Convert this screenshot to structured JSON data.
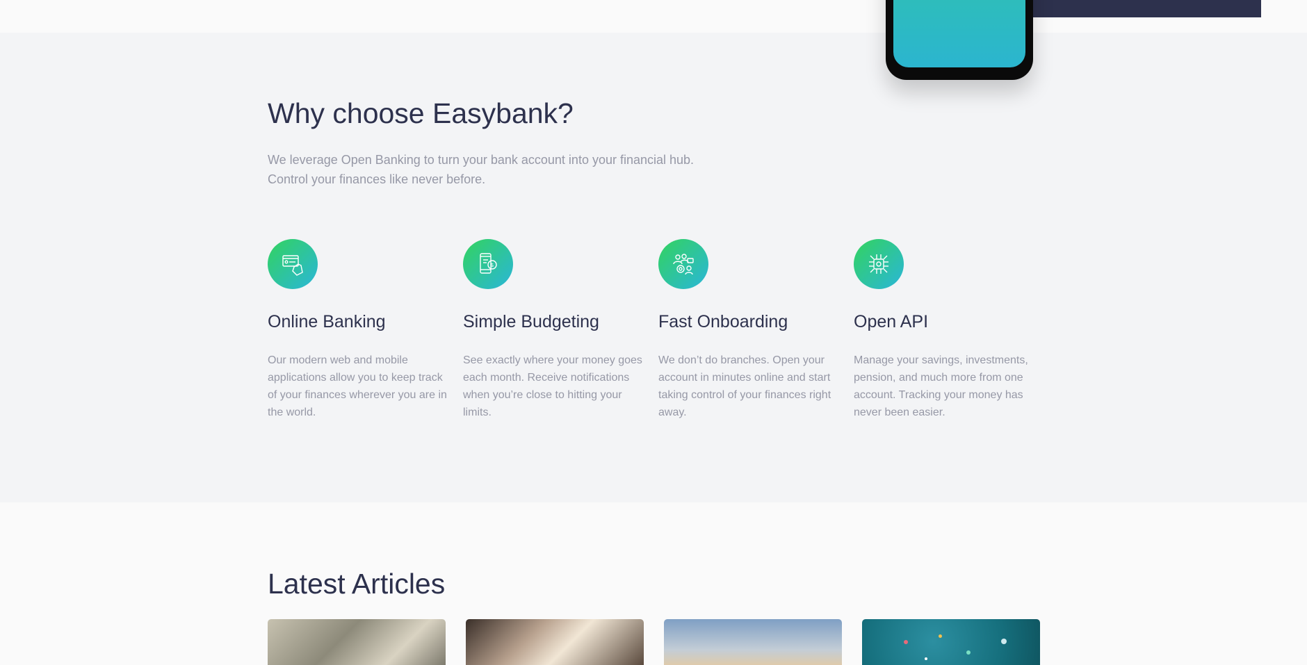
{
  "why": {
    "title": "Why choose Easybank?",
    "subtitle_line1": "We leverage Open Banking to turn your bank account into your financial hub.",
    "subtitle_line2": "Control your finances like never before.",
    "features": [
      {
        "icon": "online-banking-icon",
        "title": "Online Banking",
        "text": "Our modern web and mobile applications allow you to keep track of your finances wherever you are in the world."
      },
      {
        "icon": "budgeting-icon",
        "title": "Simple Budgeting",
        "text": "See exactly where your money goes each month. Receive notifications when you’re close to hitting your limits."
      },
      {
        "icon": "onboarding-icon",
        "title": "Fast Onboarding",
        "text": "We don’t do branches. Open your account in minutes online and start taking control of your finances right away."
      },
      {
        "icon": "api-icon",
        "title": "Open API",
        "text": "Manage your savings, investments, pension, and much more from one account. Tracking your money has never been easier."
      }
    ]
  },
  "articles": {
    "title": "Latest Articles"
  },
  "colors": {
    "navy": "#2d314d",
    "lime_green": "#31d35c",
    "bright_cyan": "#2bb7da",
    "grayish_blue": "#9698a6",
    "light_grayish_blue": "#f3f4f6"
  }
}
